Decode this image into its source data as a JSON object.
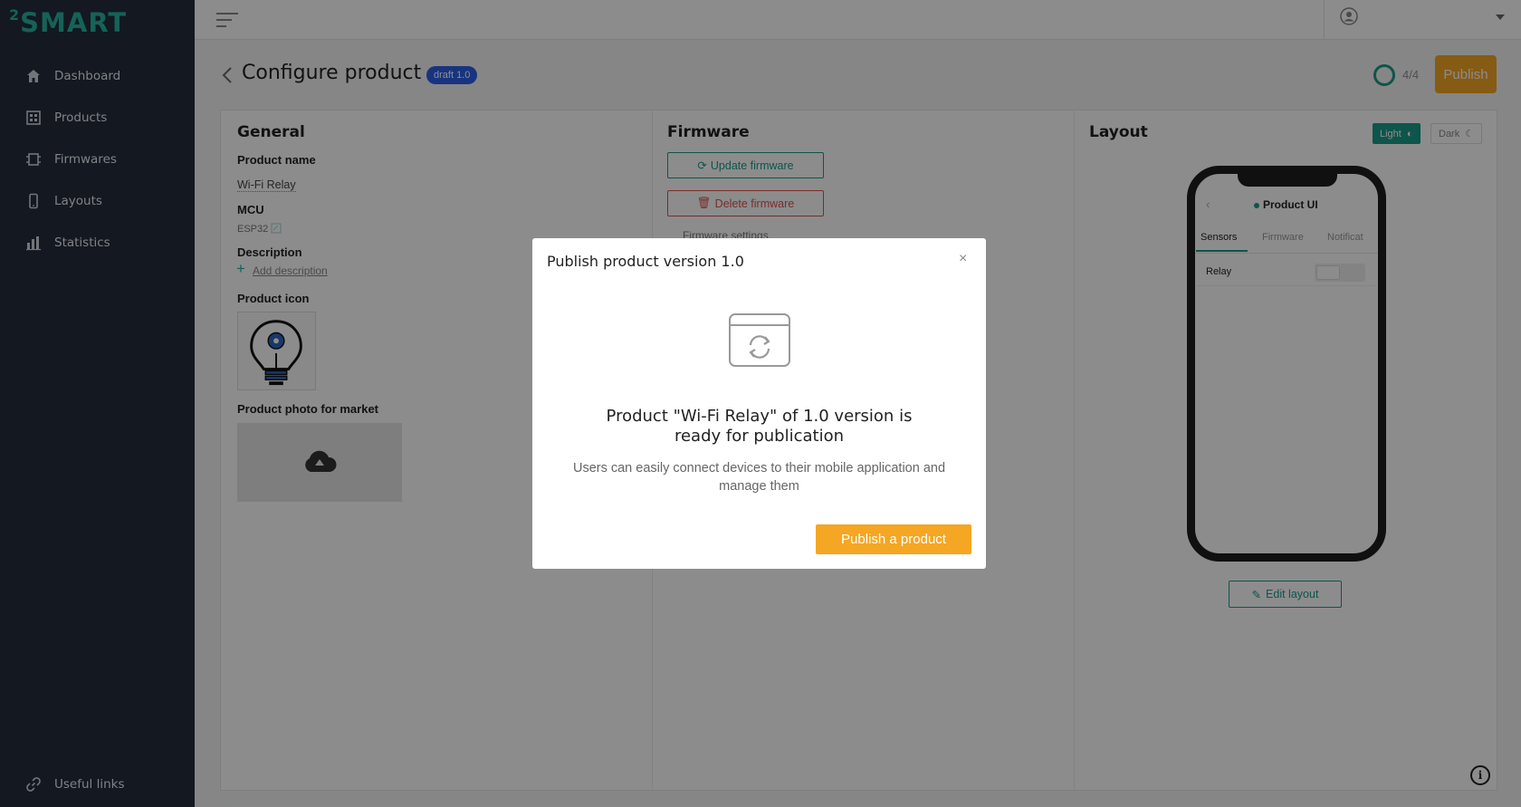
{
  "brand": {
    "logo_sup": "2",
    "logo_text": "SMART"
  },
  "sidebar": {
    "items": [
      {
        "label": "Dashboard",
        "icon": "home-icon"
      },
      {
        "label": "Products",
        "icon": "products-icon"
      },
      {
        "label": "Firmwares",
        "icon": "firmware-chip-icon"
      },
      {
        "label": "Layouts",
        "icon": "phone-icon"
      },
      {
        "label": "Statistics",
        "icon": "bar-chart-icon"
      }
    ],
    "footer_link": "Useful links"
  },
  "header": {
    "title": "Configure product",
    "badge": "draft 1.0",
    "progress": "4/4",
    "publish_label": "Publish"
  },
  "general": {
    "title": "General",
    "product_name_label": "Product name",
    "product_name": "Wi-Fi Relay",
    "mcu_label": "MCU",
    "mcu_value": "ESP32",
    "description_label": "Description",
    "add_description": "Add description",
    "icon_label": "Product icon",
    "photo_label": "Product photo for market"
  },
  "firmware": {
    "title": "Firmware",
    "update_label": "Update firmware",
    "delete_label": "Delete firmware",
    "settings_label": "Firmware settings"
  },
  "layout": {
    "title": "Layout",
    "theme_light": "Light",
    "theme_dark": "Dark",
    "phone_title": "Product UI",
    "tabs": [
      "Sensors",
      "Firmware",
      "Notificat"
    ],
    "row_label": "Relay",
    "edit_label": "Edit layout"
  },
  "modal": {
    "title": "Publish product version 1.0",
    "close": "×",
    "heading_line1": "Product \"Wi-Fi Relay\" of 1.0 version is",
    "heading_line2": "ready for publication",
    "sub_line1": "Users can easily connect devices to their mobile application and",
    "sub_line2": "manage them",
    "cta": "Publish a product"
  },
  "colors": {
    "sidebar_bg": "#232c3c",
    "accent_teal": "#1a9b89",
    "publish_orange": "#f5a623",
    "draft_blue": "#2d5fe8",
    "danger_red": "#d9534f"
  }
}
